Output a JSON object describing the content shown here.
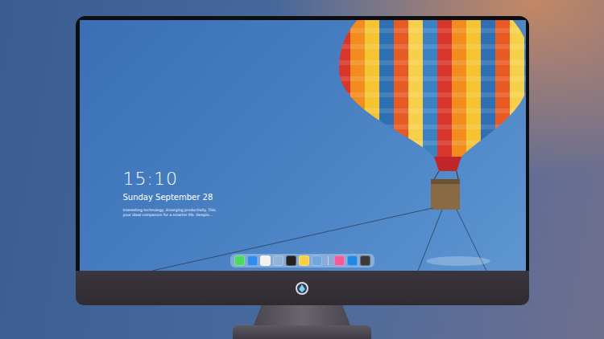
{
  "lock_screen": {
    "time": "15:10",
    "date": "Sunday September 28",
    "tagline": [
      "Interesting technology, Emerging productivity. This,",
      "your ideal companion for a smarter life. Deepin..."
    ]
  },
  "dock": {
    "items": [
      {
        "color": "#4cd964",
        "group": 1
      },
      {
        "color": "#2f8cf0",
        "group": 1
      },
      {
        "color": "#f2f2f2",
        "group": 1
      },
      {
        "color": "#8fb6d8",
        "group": 1
      },
      {
        "color": "#222222",
        "group": 1
      },
      {
        "color": "#f7d046",
        "group": 1
      },
      {
        "color": "#6fa8dc",
        "group": 1
      },
      {
        "color": "#f25a9a",
        "group": 2
      },
      {
        "color": "#1e88e5",
        "group": 2
      },
      {
        "color": "#3a3a3a",
        "group": 2
      }
    ]
  }
}
